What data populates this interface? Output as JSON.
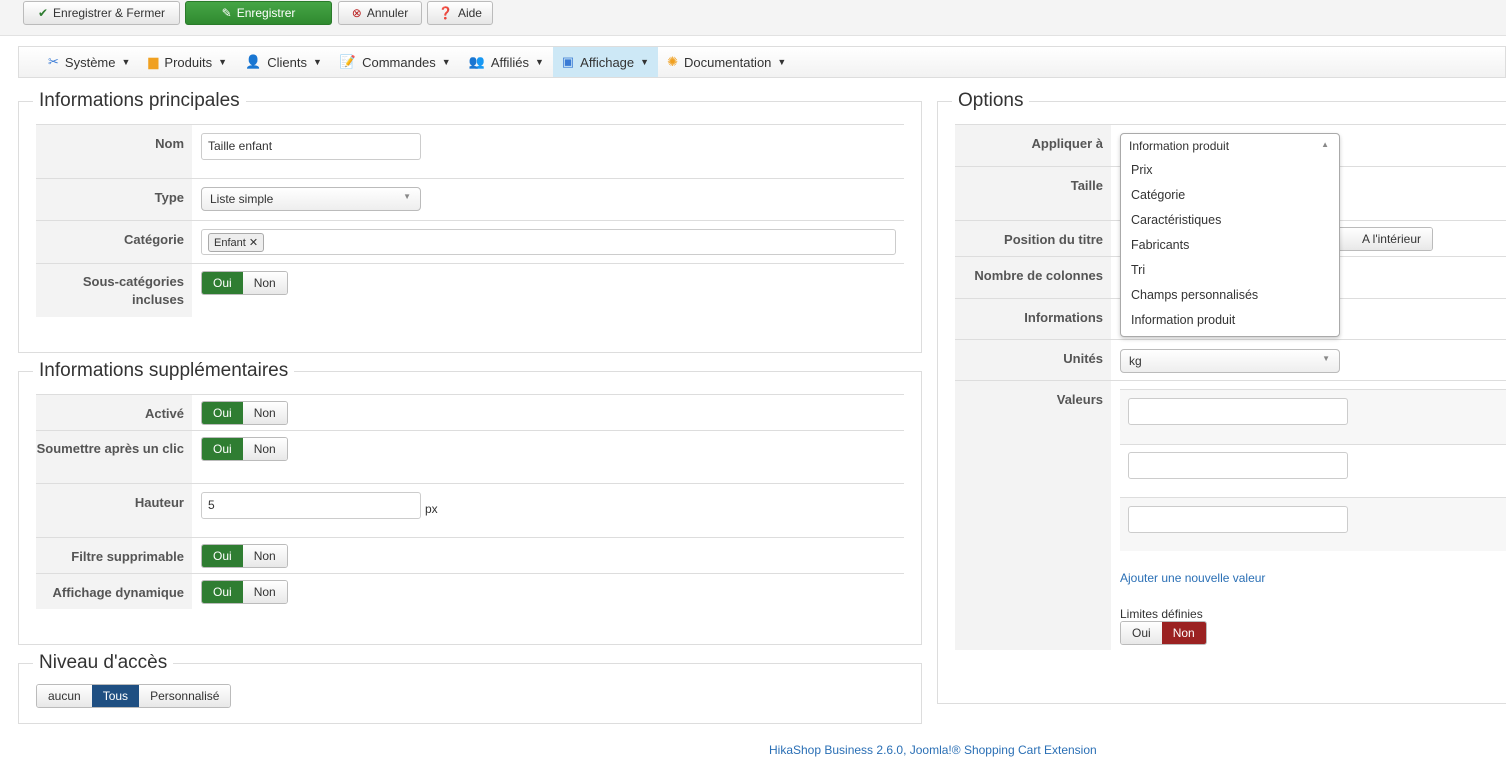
{
  "toolbar": {
    "save_close": "Enregistrer & Fermer",
    "save": "Enregistrer",
    "cancel": "Annuler",
    "help": "Aide"
  },
  "menu": [
    {
      "label": "Système"
    },
    {
      "label": "Produits"
    },
    {
      "label": "Clients"
    },
    {
      "label": "Commandes"
    },
    {
      "label": "Affiliés"
    },
    {
      "label": "Affichage"
    },
    {
      "label": "Documentation"
    }
  ],
  "main": {
    "legend": "Informations principales",
    "nom_label": "Nom",
    "nom_value": "Taille enfant",
    "type_label": "Type",
    "type_value": "Liste simple",
    "cat_label": "Catégorie",
    "cat_tag": "Enfant",
    "subcat_label": "Sous-catégories incluses"
  },
  "extra": {
    "legend": "Informations supplémentaires",
    "active": "Activé",
    "submit": "Soumettre après un clic",
    "height": "Hauteur",
    "height_value": "5",
    "height_unit": "px",
    "removable": "Filtre supprimable",
    "dynamic": "Affichage dynamique"
  },
  "yes": "Oui",
  "no": "Non",
  "access": {
    "legend": "Niveau d'accès",
    "none": "aucun",
    "all": "Tous",
    "custom": "Personnalisé"
  },
  "options": {
    "legend": "Options",
    "apply": "Appliquer à",
    "apply_value": "Information produit",
    "apply_options": [
      "Prix",
      "Catégorie",
      "Caractéristiques",
      "Fabricants",
      "Tri",
      "Champs personnalisés",
      "Information produit"
    ],
    "size": "Taille",
    "title_pos": "Position du titre",
    "inside": "A l'intérieur",
    "columns": "Nombre de colonnes",
    "info": "Informations",
    "units": "Unités",
    "units_value": "kg",
    "values": "Valeurs",
    "add_value": "Ajouter une nouvelle valeur",
    "limits": "Limites définies"
  },
  "footer": "HikaShop Business 2.6.0, Joomla!® Shopping Cart Extension"
}
